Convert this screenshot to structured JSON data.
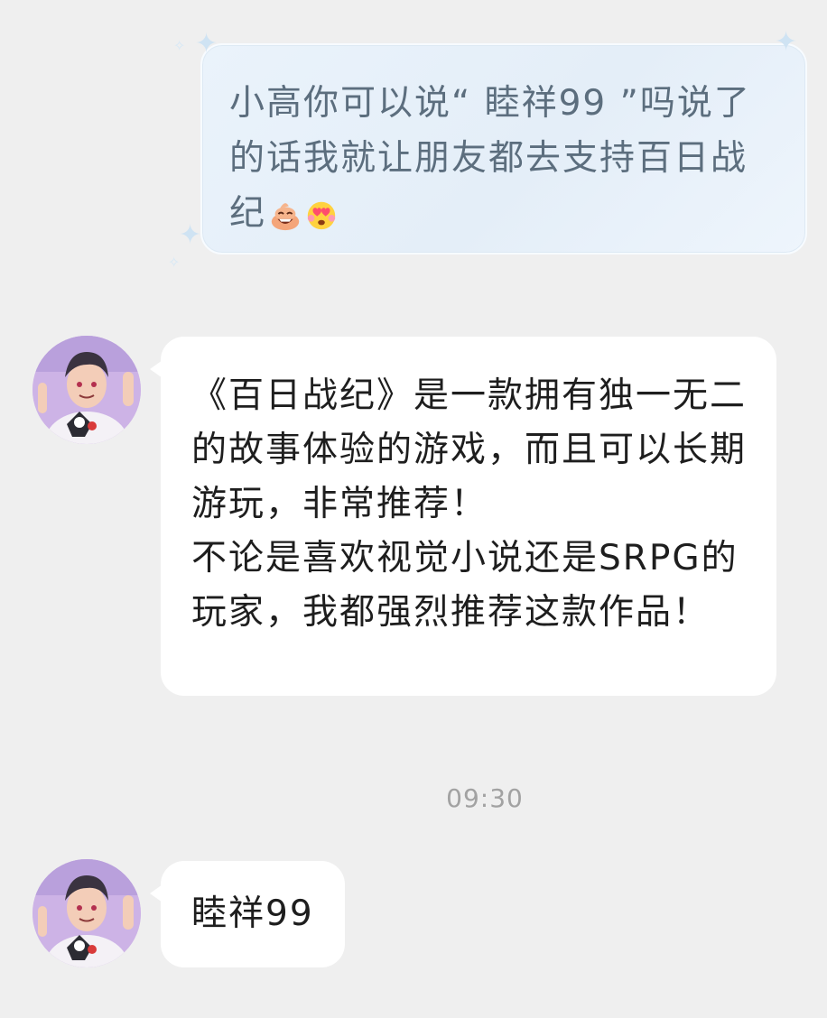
{
  "conversation": {
    "sent_message": {
      "text": "小高你可以说“ 睦祥99 ”吗说了的话我就让朋友都去支持百日战纪",
      "emojis": [
        "laughing-poop-emoji",
        "heart-eyes-emoji"
      ]
    },
    "received_messages": [
      {
        "avatar": "anime-boy-avatar",
        "text": "《百日战纪》是一款拥有独一无二的故事体验的游戏，而且可以长期游玩，非常推荐！\n不论是喜欢视觉小说还是SRPG的玩家，我都强烈推荐这款作品！"
      },
      {
        "avatar": "anime-boy-avatar",
        "text": "睦祥99"
      }
    ],
    "timestamp": "09:30"
  },
  "colors": {
    "background": "#efefef",
    "sent_bubble": "#e6f0fa",
    "sent_text": "#5c6e7e",
    "received_bubble": "#ffffff",
    "received_text": "#1e1e1e",
    "timestamp": "#a2a2a2"
  }
}
